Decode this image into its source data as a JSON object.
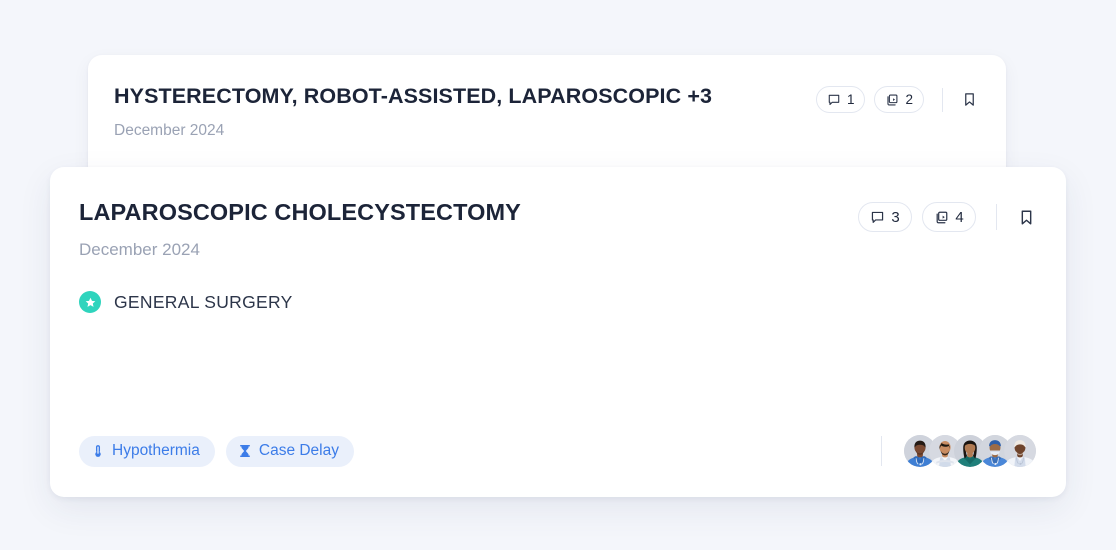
{
  "theme": {
    "page_background": "#f4f6fb",
    "card_background": "#ffffff",
    "title_color": "#1c2438",
    "muted_text_color": "#9aa2b4",
    "tag_background": "#eaf0fb",
    "tag_text_color": "#3c7ce8",
    "specialty_badge_color": "#2fd4bd",
    "border_color": "#e3e7f0"
  },
  "cards": {
    "background_card": {
      "title": "HYSTERECTOMY, ROBOT-ASSISTED, LAPAROSCOPIC +3",
      "date": "December 2024",
      "comment_count": "1",
      "attachment_count": "2",
      "comment_icon": "comment-bubble-icon",
      "attachment_icon": "layers-copy-icon",
      "bookmark_icon": "bookmark-icon"
    },
    "foreground_card": {
      "title": "LAPAROSCOPIC CHOLECYSTECTOMY",
      "date": "December 2024",
      "comment_count": "3",
      "attachment_count": "4",
      "comment_icon": "comment-bubble-icon",
      "attachment_icon": "layers-copy-icon",
      "bookmark_icon": "bookmark-icon",
      "specialty": {
        "label": "GENERAL SURGERY",
        "badge_icon": "star-badge-icon"
      },
      "tags": [
        {
          "label": "Hypothermia",
          "icon": "thermometer-icon"
        },
        {
          "label": "Case Delay",
          "icon": "hourglass-icon"
        }
      ],
      "team": {
        "avatar_count": 5,
        "avatars": [
          {
            "name": "team-member-1",
            "skin": "#7b4a32",
            "garment": "#3f7fd4",
            "garment_alt": "#2f6bbb",
            "hair": "#241a14",
            "facial_hair": true
          },
          {
            "name": "team-member-2",
            "skin": "#c98d63",
            "garment": "#f3f5f9",
            "garment_alt": "#dfe4ed",
            "hair": "#1f1810",
            "facial_hair": true
          },
          {
            "name": "team-member-3",
            "skin": "#b07a52",
            "garment": "#1f7f7a",
            "garment_alt": "#166a66",
            "hair": "#1a1410",
            "facial_hair": false
          },
          {
            "name": "team-member-4",
            "skin": "#9c6b46",
            "garment": "#4a87d8",
            "garment_alt": "#3a6fb8",
            "hair": "#2f5fa8",
            "facial_hair": false
          },
          {
            "name": "team-member-5",
            "skin": "#6f442c",
            "garment": "#f1f4f9",
            "garment_alt": "#dbe1ea",
            "hair": "#efe9e2",
            "facial_hair": false
          }
        ]
      }
    }
  }
}
